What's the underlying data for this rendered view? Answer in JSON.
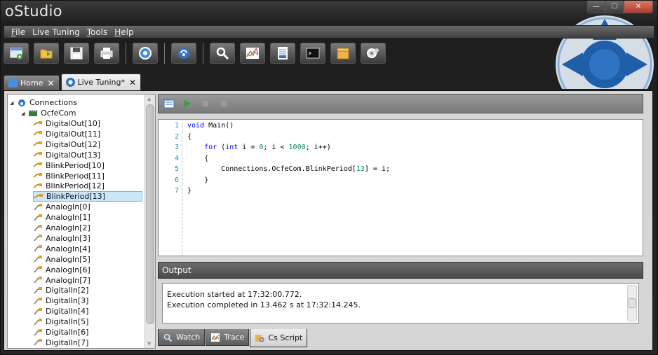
{
  "window": {
    "title": "oStudio",
    "controls": {
      "minimize": "—",
      "maximize": "☐",
      "close": "✕"
    }
  },
  "menu": [
    {
      "prefix": "",
      "mnemonic": "F",
      "rest": "ile"
    },
    {
      "prefix": "Live Tuning",
      "mnemonic": "",
      "rest": ""
    },
    {
      "prefix": "",
      "mnemonic": "T",
      "rest": "ools"
    },
    {
      "prefix": "",
      "mnemonic": "H",
      "rest": "elp"
    }
  ],
  "toolbar_icons": [
    "new-document-icon",
    "open-folder-icon",
    "save-icon",
    "print-icon",
    "settings-icon",
    "connection-icon",
    "search-icon",
    "chart-icon",
    "log-icon",
    "terminal-icon",
    "package-icon",
    "plugin-icon"
  ],
  "doc_tabs": [
    {
      "label": "Home",
      "close": "✕",
      "active": false
    },
    {
      "label": "Live Tuning*",
      "close": "✕",
      "active": true
    }
  ],
  "tree": {
    "root": "Connections",
    "device": "OcfeCom",
    "items": [
      "DigitalOut[10]",
      "DigitalOut[11]",
      "DigitalOut[12]",
      "DigitalOut[13]",
      "BlinkPeriod[10]",
      "BlinkPeriod[11]",
      "BlinkPeriod[12]",
      "BlinkPeriod[13]",
      "AnalogIn[0]",
      "AnalogIn[1]",
      "AnalogIn[2]",
      "AnalogIn[3]",
      "AnalogIn[4]",
      "AnalogIn[5]",
      "AnalogIn[6]",
      "AnalogIn[7]",
      "DigitalIn[2]",
      "DigitalIn[3]",
      "DigitalIn[4]",
      "DigitalIn[5]",
      "DigitalIn[6]",
      "DigitalIn[7]"
    ],
    "selected": "BlinkPeriod[13]"
  },
  "code": [
    {
      "n": "1",
      "text": "void Main()"
    },
    {
      "n": "2",
      "text": "{"
    },
    {
      "n": "3",
      "text": "    for (int i = 0; i < 1000; i++)"
    },
    {
      "n": "4",
      "text": "    {"
    },
    {
      "n": "5",
      "text": "        Connections.OcfeCom.BlinkPeriod[13] = i;"
    },
    {
      "n": "6",
      "text": "    }"
    },
    {
      "n": "7",
      "text": "}"
    }
  ],
  "output": {
    "title": "Output",
    "lines": [
      "Execution started at 17:32:00.772.",
      "Execution completed in 13.462 s at 17:32:14.245."
    ]
  },
  "bottom_tabs": [
    {
      "label": "Watch",
      "active": false
    },
    {
      "label": "Trace",
      "active": false
    },
    {
      "label": "Cs Script",
      "active": true
    }
  ]
}
